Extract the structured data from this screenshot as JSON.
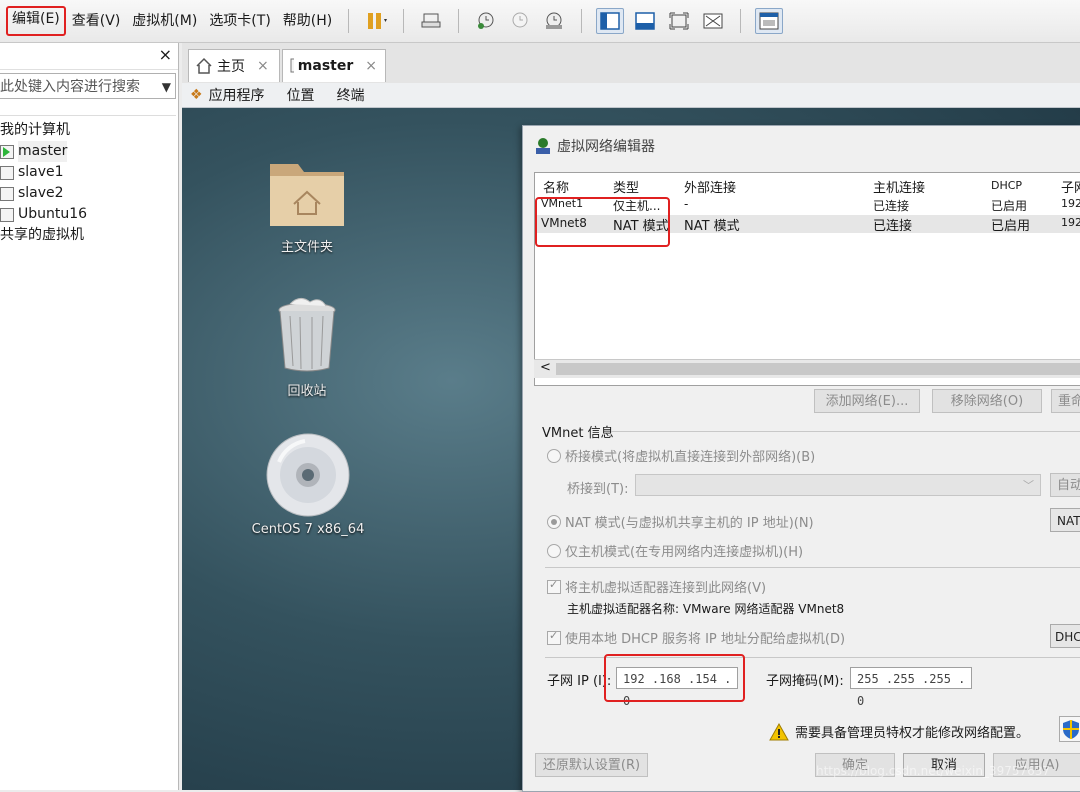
{
  "menubar": {
    "items": [
      "编辑(E)",
      "查看(V)",
      "虚拟机(M)",
      "选项卡(T)",
      "帮助(H)"
    ]
  },
  "sidebar": {
    "close_label": "×",
    "search_placeholder": "此处键入内容进行搜索",
    "tree": [
      {
        "label": "我的计算机",
        "type": "group"
      },
      {
        "label": "master",
        "type": "vm-running"
      },
      {
        "label": "slave1",
        "type": "vm"
      },
      {
        "label": "slave2",
        "type": "vm"
      },
      {
        "label": "Ubuntu16",
        "type": "vm"
      },
      {
        "label": "共享的虚拟机",
        "type": "group"
      }
    ]
  },
  "tabs": [
    {
      "label": "主页",
      "close": "×"
    },
    {
      "label": "master",
      "close": "×"
    }
  ],
  "subbar": [
    "应用程序",
    "位置",
    "终端"
  ],
  "desktop": {
    "icons": [
      "主文件夹",
      "回收站",
      "CentOS 7 x86_64"
    ]
  },
  "dialog": {
    "title": "虚拟网络编辑器",
    "columns": [
      "名称",
      "类型",
      "外部连接",
      "主机连接",
      "DHCP",
      "子网"
    ],
    "rows": [
      [
        "VMnet1",
        "仅主机...",
        "-",
        "已连接",
        "已启用",
        "192"
      ],
      [
        "VMnet8",
        "NAT 模式",
        "NAT 模式",
        "已连接",
        "已启用",
        "192"
      ]
    ],
    "scroll_arrow": "<",
    "buttons": {
      "add_network": "添加网络(E)...",
      "remove_network": "移除网络(O)",
      "rename": "重命",
      "auto": "自动",
      "nat_settings": "NAT",
      "dhcp_settings": "DHCP",
      "restore_defaults": "还原默认设置(R)",
      "ok": "确定",
      "cancel": "取消",
      "apply": "应用(A)"
    },
    "vmnet_info_label": "VMnet 信息",
    "bridge_mode": "桥接模式(将虚拟机直接连接到外部网络)(B)",
    "bridge_to_label": "桥接到(T):",
    "nat_mode": "NAT 模式(与虚拟机共享主机的 IP 地址)(N)",
    "host_only_mode": "仅主机模式(在专用网络内连接虚拟机)(H)",
    "connect_adapter": "将主机虚拟适配器连接到此网络(V)",
    "adapter_name": "主机虚拟适配器名称: VMware 网络适配器 VMnet8",
    "use_dhcp": "使用本地 DHCP 服务将 IP 地址分配给虚拟机(D)",
    "subnet_ip_label": "子网 IP (I):",
    "subnet_ip": "192 .168 .154 . 0",
    "subnet_mask_label": "子网掩码(M):",
    "subnet_mask": "255 .255 .255 . 0",
    "admin_notice": "需要具备管理员特权才能修改网络配置。"
  },
  "watermark": "https://blog.csdn.net/weixin_39757637"
}
